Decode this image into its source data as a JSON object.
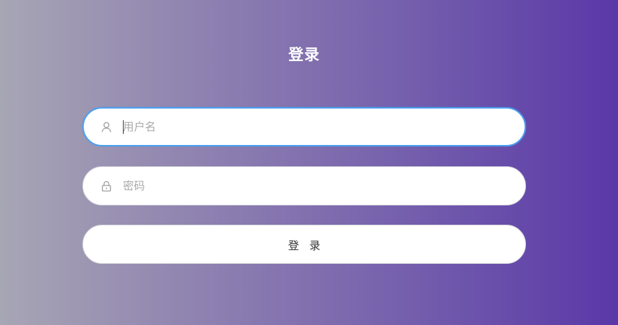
{
  "page": {
    "title": "登录"
  },
  "form": {
    "username": {
      "placeholder": "用户名",
      "value": "",
      "icon": "user-icon"
    },
    "password": {
      "placeholder": "密码",
      "value": "",
      "icon": "lock-icon"
    },
    "submit_label": "登 录"
  },
  "colors": {
    "gradient_start": "#a7a6b4",
    "gradient_end": "#5a38a7",
    "focus_border": "#4aa0f0",
    "placeholder": "#a9a9a9"
  }
}
